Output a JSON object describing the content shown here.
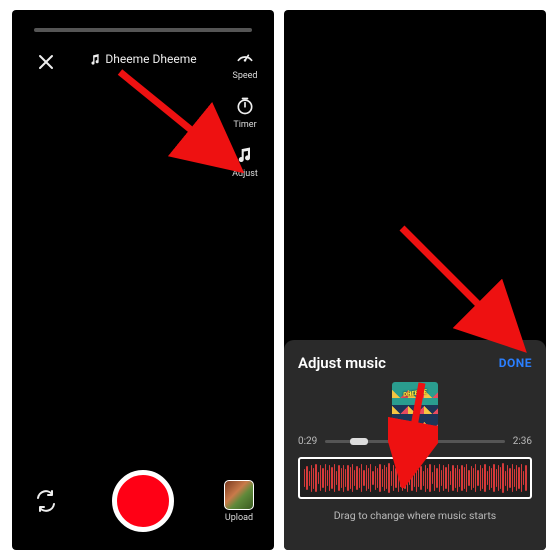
{
  "left": {
    "song_title": "Dheeme Dheeme",
    "controls": {
      "speed": "Speed",
      "timer": "Timer",
      "adjust": "Adjust"
    },
    "upload_label": "Upload"
  },
  "right": {
    "sheet_title": "Adjust music",
    "done_label": "DONE",
    "time_start": "0:29",
    "time_end": "2:36",
    "hint": "Drag to change where music starts"
  },
  "colors": {
    "record": "#ff0015",
    "accent_blue": "#2a7fff",
    "waveform": "#d63a3a"
  }
}
